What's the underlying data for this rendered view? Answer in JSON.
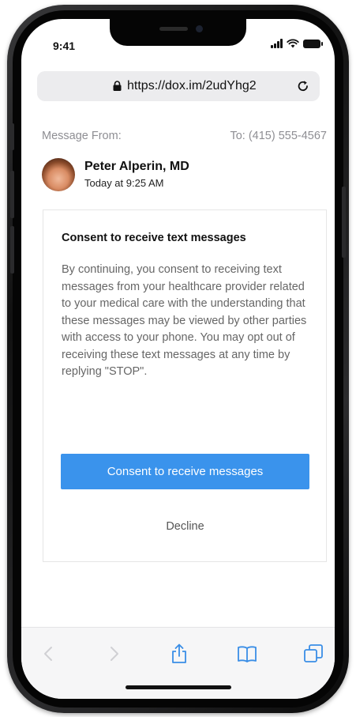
{
  "status_bar": {
    "time": "9:41"
  },
  "browser": {
    "url": "https://dox.im/2udYhg2"
  },
  "message": {
    "from_label": "Message From:",
    "to_label": "To: (415) 555-4567",
    "sender_name": "Peter Alperin, MD",
    "sent_time": "Today at 9:25 AM"
  },
  "consent_card": {
    "title": "Consent to receive text messages",
    "body": "By continuing, you consent to receiving text messages from your healthcare provider related to your medical care with the understanding that these messages may be viewed by other parties with access to your phone. You may opt out of receiving these text messages at any time by replying \"STOP\".",
    "consent_button_label": "Consent to receive messages",
    "decline_label": "Decline"
  },
  "toolbar": {
    "icons": [
      "back-icon",
      "forward-icon",
      "share-icon",
      "bookmarks-icon",
      "tabs-icon"
    ]
  },
  "colors": {
    "accent": "#3a93ec",
    "toolbar_icon": "#3a8ee6",
    "muted_text": "#8e8e93"
  }
}
